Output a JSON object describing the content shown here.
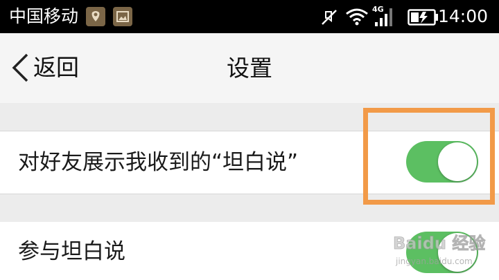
{
  "status_bar": {
    "carrier": "中国移动",
    "network_type": "4G",
    "time": "14:00",
    "icons": [
      "notification-app-icon",
      "notification-image-icon",
      "mute-icon",
      "wifi-icon",
      "signal-icon",
      "battery-charging-icon"
    ]
  },
  "nav": {
    "back_label": "返回",
    "title": "设置"
  },
  "settings": [
    {
      "label": "对好友展示我收到的“坦白说”",
      "enabled": true
    },
    {
      "label": "参与坦白说",
      "enabled": true
    }
  ],
  "highlight_color": "#f29a48",
  "toggle_on_color": "#5cbf62",
  "watermark": {
    "brand": "Baidu 经验",
    "url": "jingyan.baidu.com"
  }
}
